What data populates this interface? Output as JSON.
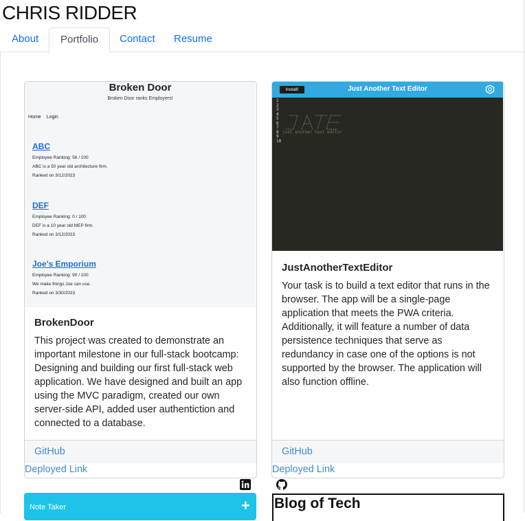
{
  "site": {
    "title": "CHRIS RIDDER"
  },
  "nav": {
    "tabs": [
      "About",
      "Portfolio",
      "Contact",
      "Resume"
    ],
    "active": "Portfolio"
  },
  "colors": {
    "link": "#3d8bd8",
    "nav_link": "#0d6efd",
    "note_taker_bg": "#1ec3ea",
    "jate_bar": "#31a9e1",
    "jate_editor": "#272822"
  },
  "projects": [
    {
      "title": "BrokenDoor",
      "description": "This project was created to demonstrate an important milestone in our full-stack bootcamp: Designing and building our first full-stack web application. We have designed and built an app using the MVC paradigm, created our own server-side API, added user authentiction and connected to a database.",
      "github_label": "GitHub",
      "deployed_label": "Deployed Link",
      "screenshot": {
        "title": "Broken Door",
        "subtitle": "Broken Door ranks Employers!",
        "nav": [
          "Home",
          "Login"
        ],
        "companies": [
          {
            "name": "ABC",
            "ranking": "Employee Ranking: 56 / 100",
            "desc": "ABC is a 50 year old architecture firm.",
            "ranked": "Ranked on 3/12/2023"
          },
          {
            "name": "DEF",
            "ranking": "Employee Ranking: 0 / 100",
            "desc": "DEF is a 10 year old MEP firm.",
            "ranked": "Ranked on 3/12/2023"
          },
          {
            "name": "Joe's Emporium",
            "ranking": "Employee Ranking: 90 / 100",
            "desc": "We make things Joe can use.",
            "ranked": "Ranked on 3/30/2023"
          }
        ]
      }
    },
    {
      "title": "JustAnotherTextEditor",
      "description": "Your task is to build a text editor that runs in the browser. The app will be a single-page application that meets the PWA criteria. Additionally, it will feature a number of data persistence techniques that serve as redundancy in case one of the options is not supported by the browser. The application will also function offline.",
      "github_label": "GitHub",
      "deployed_label": "Deployed Link",
      "screenshot": {
        "install_label": "Install!",
        "title": "Just Another Text Editor",
        "logo_caption": "JATE",
        "line_numbers": [
          "1",
          "2",
          "3",
          "4",
          "5",
          "6",
          "7",
          "8",
          "9",
          "10"
        ],
        "comment_open": "/*",
        "comment_text": "just another text editor",
        "comment_close": "*/"
      }
    }
  ],
  "icons": {
    "linkedin": "linkedin-icon",
    "github": "github-icon",
    "plus": "plus-icon"
  },
  "bottom_cards": [
    {
      "title": "Note Taker",
      "action": "+"
    },
    {
      "title": "Blog of Tech"
    }
  ]
}
